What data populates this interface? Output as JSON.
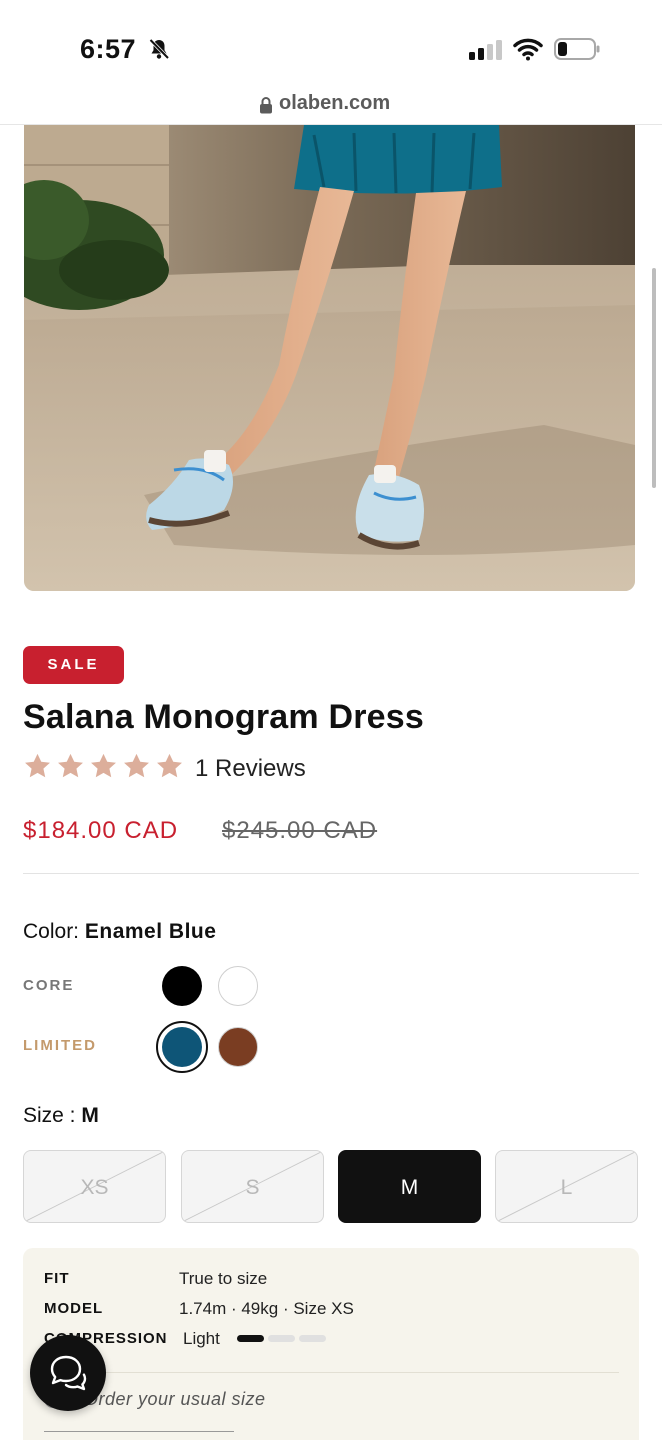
{
  "status_bar": {
    "time": "6:57"
  },
  "browser": {
    "url": "olaben.com"
  },
  "product": {
    "badge": "SALE",
    "title": "Salana Monogram Dress",
    "rating": 5,
    "reviews_label": "1 Reviews",
    "price": "$184.00 CAD",
    "compare_price": "$245.00 CAD"
  },
  "color": {
    "label": "Color:",
    "selected": "Enamel Blue",
    "groups": [
      {
        "name": "CORE",
        "color": "#777777",
        "swatches": [
          "#000000",
          "#ffffff"
        ]
      },
      {
        "name": "LIMITED",
        "color": "#c49a6c",
        "swatches": [
          "#0e5577",
          "#7a3d22"
        ]
      }
    ]
  },
  "size": {
    "label": "Size :",
    "selected": "M",
    "options": [
      {
        "label": "XS",
        "available": false
      },
      {
        "label": "S",
        "available": false
      },
      {
        "label": "M",
        "available": true
      },
      {
        "label": "L",
        "available": false
      }
    ]
  },
  "fit": {
    "rows": [
      {
        "key": "FIT",
        "value": "True to size"
      },
      {
        "key": "MODEL",
        "value": "1.74m · 49kg · Size XS"
      },
      {
        "key": "COMPRESSION",
        "value": "Light"
      }
    ],
    "compression_level": 1,
    "compression_max": 3,
    "tip": "Order your usual size"
  },
  "colors": {
    "sale": "#c8202f",
    "star": "#dcae9b",
    "panel": "#f6f4ec"
  }
}
